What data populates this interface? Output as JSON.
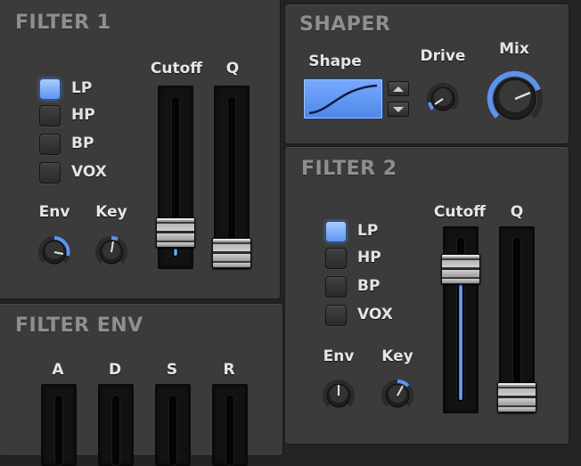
{
  "filter1": {
    "title": "FILTER 1",
    "modes": [
      {
        "label": "LP",
        "active": true
      },
      {
        "label": "HP",
        "active": false
      },
      {
        "label": "BP",
        "active": false
      },
      {
        "label": "VOX",
        "active": false
      }
    ],
    "cutoff_label": "Cutoff",
    "q_label": "Q",
    "env_label": "Env",
    "key_label": "Key",
    "cutoff_level": 0.25,
    "q_level": 0.08
  },
  "shaper": {
    "title": "SHAPER",
    "shape_label": "Shape",
    "drive_label": "Drive",
    "mix_label": "Mix"
  },
  "filter2": {
    "title": "FILTER 2",
    "modes": [
      {
        "label": "LP",
        "active": true
      },
      {
        "label": "HP",
        "active": false
      },
      {
        "label": "BP",
        "active": false
      },
      {
        "label": "VOX",
        "active": false
      }
    ],
    "cutoff_label": "Cutoff",
    "q_label": "Q",
    "env_label": "Env",
    "key_label": "Key",
    "cutoff_level": 0.85,
    "q_level": 0.08
  },
  "filter_env": {
    "title": "FILTER ENV",
    "stages": [
      "A",
      "D",
      "S",
      "R"
    ]
  },
  "colors": {
    "accent": "#5b93f0",
    "panel": "#3b3b3b",
    "background": "#232323",
    "title": "#8f8f8f"
  }
}
